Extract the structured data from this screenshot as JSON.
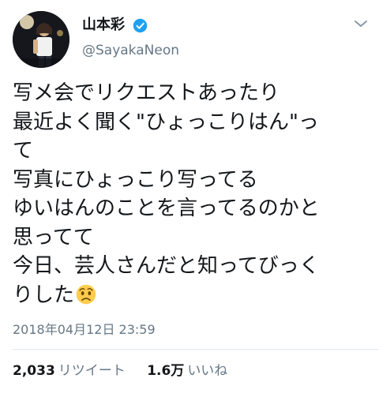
{
  "user": {
    "display_name": "山本彩",
    "handle": "@SayakaNeon",
    "verified": true
  },
  "tweet": {
    "lines": [
      "写メ会でリクエストあったり",
      "最近よく聞く\"ひょっこりはん\"っ",
      "て",
      "写真にひょっこり写ってる",
      "ゆいはんのことを言ってるのかと",
      "思ってて",
      "今日、芸人さんだと知ってびっく",
      "りした"
    ],
    "emoji": "worried-face",
    "timestamp": "2018年04月12日 23:59"
  },
  "stats": {
    "retweets_count": "2,033",
    "retweets_label": "リツイート",
    "likes_count": "1.6万",
    "likes_label": "いいね"
  },
  "colors": {
    "verified_blue": "#1da1f2",
    "secondary_text": "#657786",
    "divider": "#e1e8ed"
  }
}
